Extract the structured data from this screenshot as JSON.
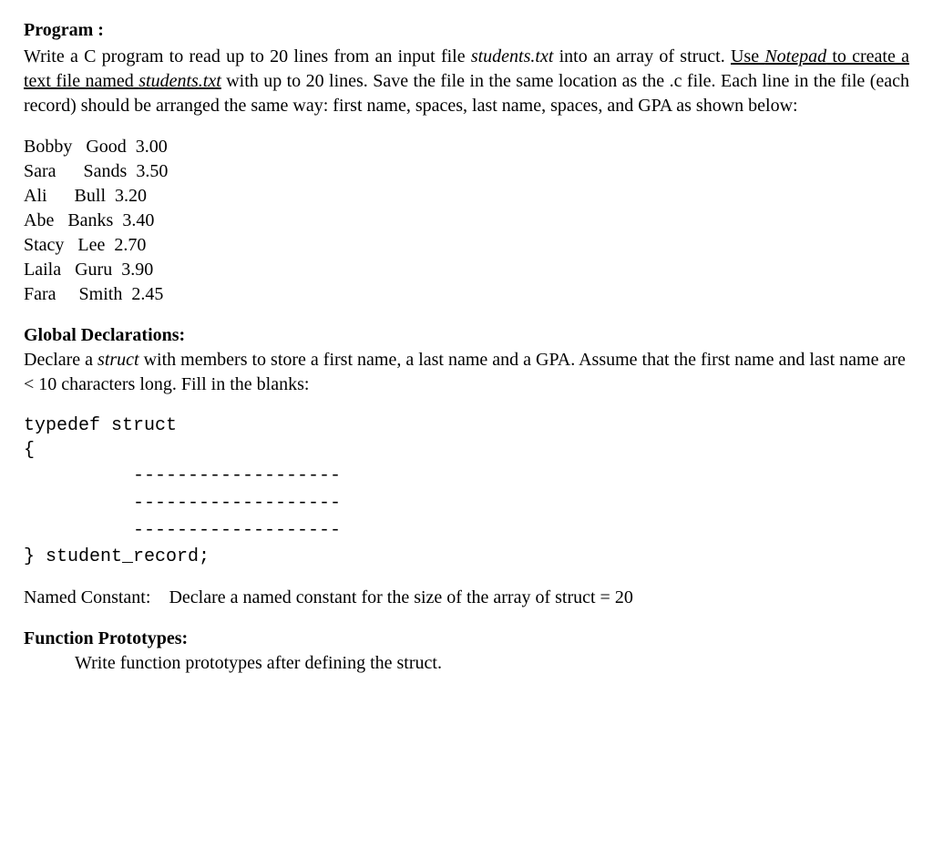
{
  "heading": "Program :",
  "intro": {
    "t1": "Write a C program to read up to 20 lines from an input file ",
    "file1_italic": "students.txt",
    "t2": " into an array of struct. ",
    "underlined": {
      "u1": "Use ",
      "notepad_italic": "Notepad",
      "u2": " to create a text file named ",
      "file2_italic": "students.txt"
    },
    "t3": " with up to 20 lines. Save the file in the same location as the .c file. Each line in the file (each record) should be arranged the same way:  first name, spaces, last name, spaces, and GPA as shown below:"
  },
  "sample_data": [
    "Bobby   Good  3.00",
    "Sara      Sands  3.50",
    "Ali      Bull  3.20",
    "Abe   Banks  3.40",
    "Stacy   Lee  2.70",
    "Laila   Guru  3.90",
    "Fara     Smith  2.45"
  ],
  "global_decl": {
    "heading": "Global Declarations:",
    "t1": "Declare a ",
    "struct_italic": "struct",
    "t2": " with members to store a first name, a last name and a GPA. Assume that the first name and last name are <  10 characters long. Fill in the blanks:"
  },
  "struct_code": {
    "line1": "typedef struct",
    "line2": "{",
    "blank1": "          -------------------",
    "blank2": "          -------------------",
    "blank3": "          -------------------",
    "line_end": "} student_record;"
  },
  "named_const": {
    "label": "Named Constant:",
    "text": "Declare a named constant for the size of the array of struct = 20"
  },
  "func_proto": {
    "heading": "Function Prototypes:",
    "text": "Write function prototypes after defining the struct."
  }
}
